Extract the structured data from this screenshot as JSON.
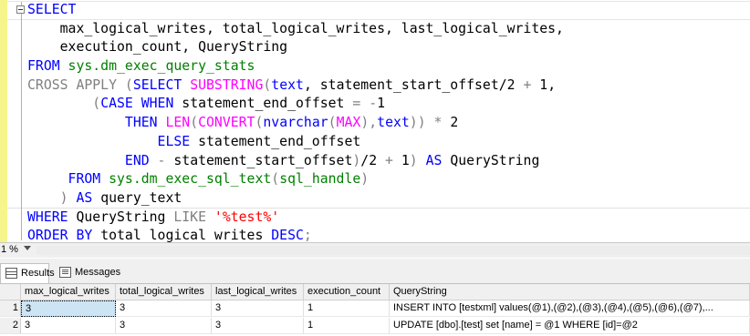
{
  "editor": {
    "lines": [
      [
        {
          "t": "SELECT",
          "c": "kw"
        }
      ],
      [
        {
          "t": "    max_logical_writes, total_logical_writes, last_logical_writes,",
          "c": ""
        }
      ],
      [
        {
          "t": "    execution_count, QueryString",
          "c": ""
        }
      ],
      [
        {
          "t": "FROM ",
          "c": "kw"
        },
        {
          "t": "sys.dm_exec_query_stats",
          "c": "sys"
        }
      ],
      [
        {
          "t": "CROSS APPLY ",
          "c": "gr"
        },
        {
          "t": "(",
          "c": "gr"
        },
        {
          "t": "SELECT ",
          "c": "kw"
        },
        {
          "t": "SUBSTRING",
          "c": "fn"
        },
        {
          "t": "(",
          "c": "gr"
        },
        {
          "t": "text",
          "c": "kw"
        },
        {
          "t": ", statement_start_offset/2 ",
          "c": ""
        },
        {
          "t": "+",
          "c": "gr"
        },
        {
          "t": " 1,",
          "c": ""
        }
      ],
      [
        {
          "t": "        ",
          "c": ""
        },
        {
          "t": "(",
          "c": "gr"
        },
        {
          "t": "CASE WHEN ",
          "c": "kw"
        },
        {
          "t": "statement_end_offset ",
          "c": ""
        },
        {
          "t": "=",
          "c": "gr"
        },
        {
          "t": " ",
          "c": ""
        },
        {
          "t": "-",
          "c": "gr"
        },
        {
          "t": "1",
          "c": ""
        }
      ],
      [
        {
          "t": "            ",
          "c": ""
        },
        {
          "t": "THEN ",
          "c": "kw"
        },
        {
          "t": "LEN",
          "c": "fn"
        },
        {
          "t": "(",
          "c": "gr"
        },
        {
          "t": "CONVERT",
          "c": "fn"
        },
        {
          "t": "(",
          "c": "gr"
        },
        {
          "t": "nvarchar",
          "c": "kw"
        },
        {
          "t": "(",
          "c": "gr"
        },
        {
          "t": "MAX",
          "c": "fn"
        },
        {
          "t": "),",
          "c": "gr"
        },
        {
          "t": "text",
          "c": "kw"
        },
        {
          "t": ")) ",
          "c": "gr"
        },
        {
          "t": "*",
          "c": "gr"
        },
        {
          "t": " 2",
          "c": ""
        }
      ],
      [
        {
          "t": "                ",
          "c": ""
        },
        {
          "t": "ELSE ",
          "c": "kw"
        },
        {
          "t": "statement_end_offset",
          "c": ""
        }
      ],
      [
        {
          "t": "            ",
          "c": ""
        },
        {
          "t": "END ",
          "c": "kw"
        },
        {
          "t": "-",
          "c": "gr"
        },
        {
          "t": " statement_start_offset",
          "c": ""
        },
        {
          "t": ")",
          "c": "gr"
        },
        {
          "t": "/2 ",
          "c": ""
        },
        {
          "t": "+",
          "c": "gr"
        },
        {
          "t": " 1",
          "c": ""
        },
        {
          "t": ")",
          "c": "gr"
        },
        {
          "t": " ",
          "c": ""
        },
        {
          "t": "AS ",
          "c": "kw"
        },
        {
          "t": "QueryString",
          "c": ""
        }
      ],
      [
        {
          "t": "     ",
          "c": ""
        },
        {
          "t": "FROM ",
          "c": "kw"
        },
        {
          "t": "sys.dm_exec_sql_text",
          "c": "sys"
        },
        {
          "t": "(",
          "c": "gr"
        },
        {
          "t": "sql_handle",
          "c": "sys"
        },
        {
          "t": ")",
          "c": "gr"
        }
      ],
      [
        {
          "t": "    ",
          "c": ""
        },
        {
          "t": ") ",
          "c": "gr"
        },
        {
          "t": "AS ",
          "c": "kw"
        },
        {
          "t": "query_text",
          "c": ""
        }
      ],
      [
        {
          "t": "WHERE ",
          "c": "kw"
        },
        {
          "t": "QueryString ",
          "c": ""
        },
        {
          "t": "LIKE ",
          "c": "gr"
        },
        {
          "t": "'%test%'",
          "c": "str"
        }
      ],
      [
        {
          "t": "ORDER BY ",
          "c": "kw"
        },
        {
          "t": "total_logical_writes ",
          "c": ""
        },
        {
          "t": "DESC",
          "c": "kw"
        },
        {
          "t": ";",
          "c": "gr"
        }
      ]
    ]
  },
  "zoom": {
    "value": "1 %"
  },
  "tabs": {
    "results": "Results",
    "messages": "Messages"
  },
  "grid": {
    "columns": [
      "max_logical_writes",
      "total_logical_writes",
      "last_logical_writes",
      "execution_count",
      "QueryString"
    ],
    "rows": [
      {
        "num": "1",
        "cells": [
          "3",
          "3",
          "3",
          "1",
          "INSERT INTO [testxml] values(@1),(@2),(@3),(@4),(@5),(@6),(@7),..."
        ]
      },
      {
        "num": "2",
        "cells": [
          "3",
          "3",
          "3",
          "1",
          "UPDATE [dbo].[test] set [name] = @1  WHERE [id]=@2"
        ]
      }
    ]
  }
}
